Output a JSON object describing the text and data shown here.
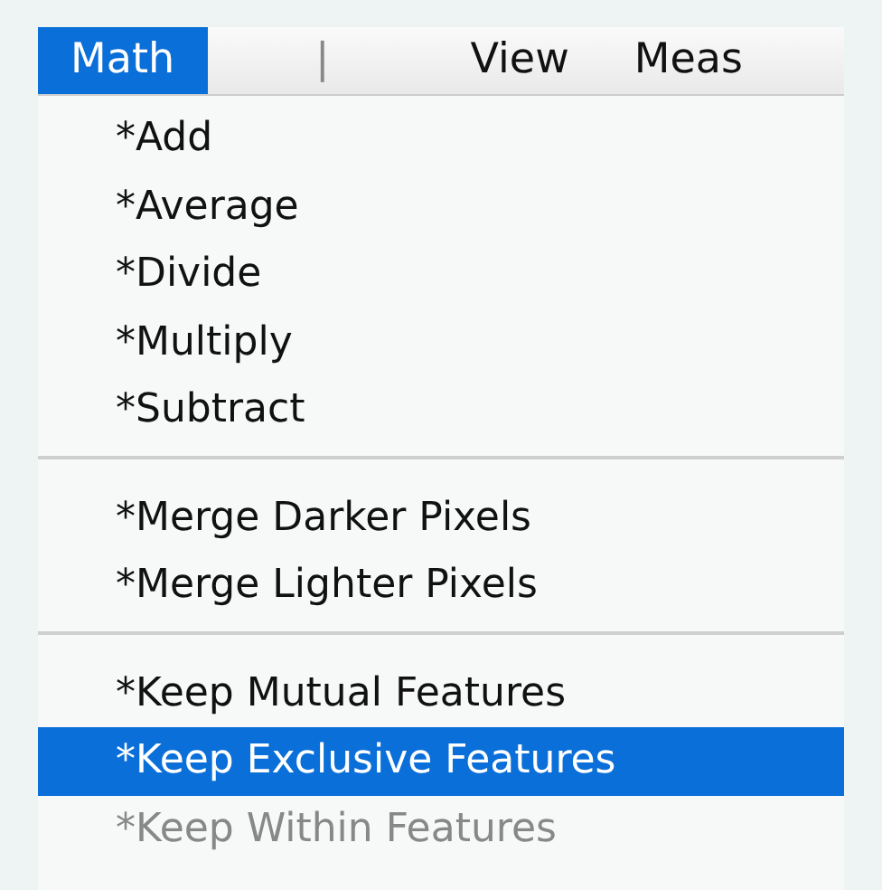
{
  "menubar": [
    {
      "label": "Math",
      "selected": true
    },
    {
      "label": "|",
      "selected": false
    },
    {
      "label": "View",
      "selected": false
    },
    {
      "label": "Meas",
      "selected": false
    }
  ],
  "menu": [
    {
      "kind": "item",
      "label": "*Add",
      "selected": false,
      "disabled": false
    },
    {
      "kind": "item",
      "label": "*Average",
      "selected": false,
      "disabled": false
    },
    {
      "kind": "item",
      "label": "*Divide",
      "selected": false,
      "disabled": false
    },
    {
      "kind": "item",
      "label": "*Multiply",
      "selected": false,
      "disabled": false
    },
    {
      "kind": "item",
      "label": "*Subtract",
      "selected": false,
      "disabled": false
    },
    {
      "kind": "separator"
    },
    {
      "kind": "item",
      "label": "*Merge Darker Pixels",
      "selected": false,
      "disabled": false
    },
    {
      "kind": "item",
      "label": "*Merge Lighter Pixels",
      "selected": false,
      "disabled": false
    },
    {
      "kind": "separator"
    },
    {
      "kind": "item",
      "label": "*Keep Mutual Features",
      "selected": false,
      "disabled": false
    },
    {
      "kind": "item",
      "label": "*Keep Exclusive Features",
      "selected": true,
      "disabled": false
    },
    {
      "kind": "item",
      "label": "*Keep Within Features",
      "selected": false,
      "disabled": true
    }
  ]
}
